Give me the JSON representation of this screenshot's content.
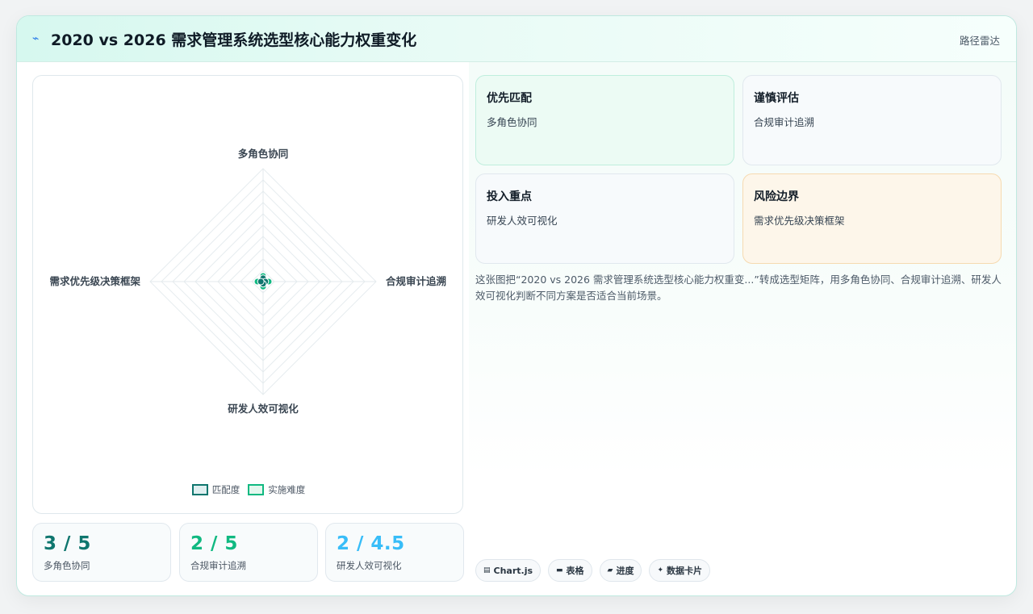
{
  "header": {
    "icon": "sparkline-icon",
    "title": "2020 vs 2026 需求管理系统选型核心能力权重变化",
    "mode": "路径雷达"
  },
  "chart_data": {
    "type": "radar",
    "axes": [
      "多角色协同",
      "合规审计追溯",
      "研发人效可视化",
      "需求优先级决策框架"
    ],
    "series": [
      {
        "name": "匹配度",
        "values": [
          3,
          2,
          2,
          2
        ],
        "color": "#0f766e"
      },
      {
        "name": "实施难度",
        "values": [
          5,
          5,
          4.5,
          5
        ],
        "color": "#10b981"
      }
    ],
    "range": [
      0,
      100
    ],
    "grid": true,
    "legend": "bottom"
  },
  "legend": {
    "items": [
      "匹配度",
      "实施难度"
    ]
  },
  "tiles": [
    {
      "title": "优先匹配",
      "sub": "多角色协同",
      "bg": "#ecfbf4",
      "border": "#bfeedd"
    },
    {
      "title": "谨慎评估",
      "sub": "合规审计追溯",
      "bg": "#f7fafc",
      "border": "#e1e8ee"
    },
    {
      "title": "投入重点",
      "sub": "研发人效可视化",
      "bg": "#f7fafc",
      "border": "#e1e8ee"
    },
    {
      "title": "风险边界",
      "sub": "需求优先级决策框架",
      "bg": "#fdf6ea",
      "border": "#f6dab0"
    }
  ],
  "description": "这张图把“2020 vs 2026 需求管理系统选型核心能力权重变...”转成选型矩阵，用多角色协同、合规审计追溯、研发人效可视化判断不同方案是否适合当前场景。",
  "kpis": [
    {
      "value": "3 / 5",
      "label": "多角色协同",
      "color": "#0f766e"
    },
    {
      "value": "2 / 5",
      "label": "合规审计追溯",
      "color": "#10b981"
    },
    {
      "value": "2 / 4.5",
      "label": "研发人效可视化",
      "color": "#38bdf8"
    }
  ],
  "chips": [
    {
      "icon": "▤",
      "label": "Chart.js"
    },
    {
      "icon": "▬",
      "label": "表格"
    },
    {
      "icon": "▰",
      "label": "进度"
    },
    {
      "icon": "✦",
      "label": "数据卡片"
    }
  ]
}
